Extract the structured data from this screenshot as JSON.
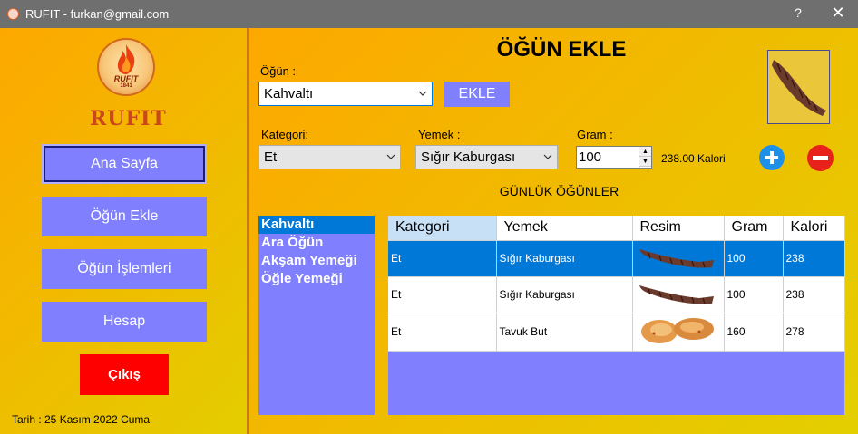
{
  "window": {
    "title": "RUFIT - furkan@gmail.com",
    "help": "?",
    "close": "✕"
  },
  "sidebar": {
    "brand": "RUFIT",
    "logo_text": "RUFIT",
    "logo_year": "1841",
    "items": [
      {
        "label": "Ana Sayfa"
      },
      {
        "label": "Öğün Ekle"
      },
      {
        "label": "Öğün İşlemleri"
      },
      {
        "label": "Hesap"
      }
    ],
    "exit_label": "Çıkış",
    "date": "Tarih : 25 Kasım 2022 Cuma"
  },
  "main": {
    "title": "ÖĞÜN EKLE",
    "meal_label": "Öğün :",
    "meal_value": "Kahvaltı",
    "add_label": "EKLE",
    "category_label": "Kategori:",
    "category_value": "Et",
    "food_label": "Yemek :",
    "food_value": "Sığır Kaburgası",
    "gram_label": "Gram :",
    "gram_value": "100",
    "calorie_text": "238.00 Kalori",
    "section_title": "GÜNLÜK ÖĞÜNLER",
    "meals": [
      "Kahvaltı",
      "Ara Öğün",
      "Akşam Yemeği",
      "Öğle Yemeği"
    ],
    "table": {
      "columns": [
        "Kategori",
        "Yemek",
        "Resim",
        "Gram",
        "Kalori"
      ],
      "rows": [
        {
          "category": "Et",
          "food": "Sığır Kaburgası",
          "image": "ribs-image",
          "gram": "100",
          "calorie": "238"
        },
        {
          "category": "Et",
          "food": "Sığır Kaburgası",
          "image": "ribs-image",
          "gram": "100",
          "calorie": "238"
        },
        {
          "category": "Et",
          "food": "Tavuk But",
          "image": "chicken-thigh-image",
          "gram": "160",
          "calorie": "278"
        }
      ]
    }
  },
  "colors": {
    "button": "#8080ff",
    "selection": "#0078d7",
    "exit": "#ff0000",
    "brand": "#c8471b"
  }
}
